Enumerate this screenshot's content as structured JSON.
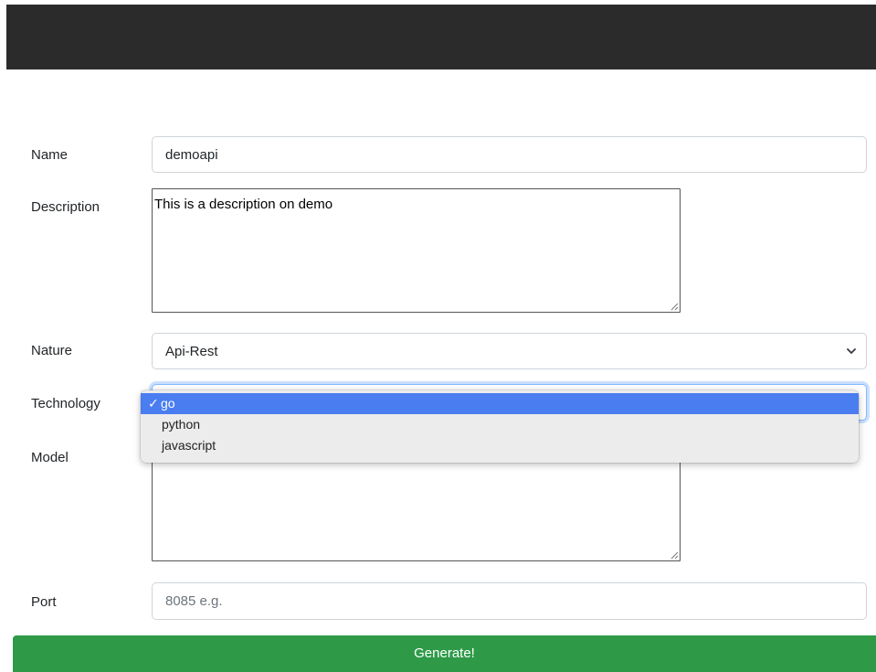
{
  "form": {
    "name_label": "Name",
    "name_value": "demoapi",
    "description_label": "Description",
    "description_value": "This is a description on demo",
    "nature_label": "Nature",
    "nature_value": "Api-Rest",
    "technology_label": "Technology",
    "technology_options": [
      "go",
      "python",
      "javascript"
    ],
    "technology_selected": "go",
    "model_label": "Model",
    "model_value": "",
    "port_label": "Port",
    "port_placeholder": "8085 e.g.",
    "generate_label": "Generate!"
  },
  "dropdown": {
    "check_glyph": "✓"
  },
  "colors": {
    "topbar": "#2b2b2b",
    "selected_option": "#4a7df0",
    "focus_ring": "#86b7fe",
    "generate_button": "#2e9a48"
  }
}
